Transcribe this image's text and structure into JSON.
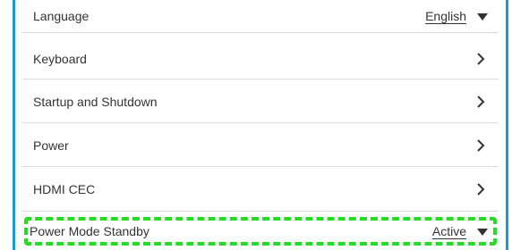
{
  "settings": {
    "items": [
      {
        "label": "Language",
        "kind": "dropdown",
        "value": "English",
        "icon": "caret-down-icon"
      },
      {
        "label": "Keyboard",
        "kind": "link",
        "icon": "chevron-right-icon"
      },
      {
        "label": "Startup and Shutdown",
        "kind": "link",
        "icon": "chevron-right-icon"
      },
      {
        "label": "Power",
        "kind": "link",
        "icon": "chevron-right-icon"
      },
      {
        "label": "HDMI CEC",
        "kind": "link",
        "icon": "chevron-right-icon"
      },
      {
        "label": "Power Mode Standby",
        "kind": "dropdown",
        "value": "Active",
        "icon": "caret-down-icon",
        "highlighted": true
      }
    ]
  },
  "colors": {
    "panel_border": "#1a9ad6",
    "divider": "#dcdcdc",
    "text": "#333333",
    "highlight": "#22dd22"
  }
}
